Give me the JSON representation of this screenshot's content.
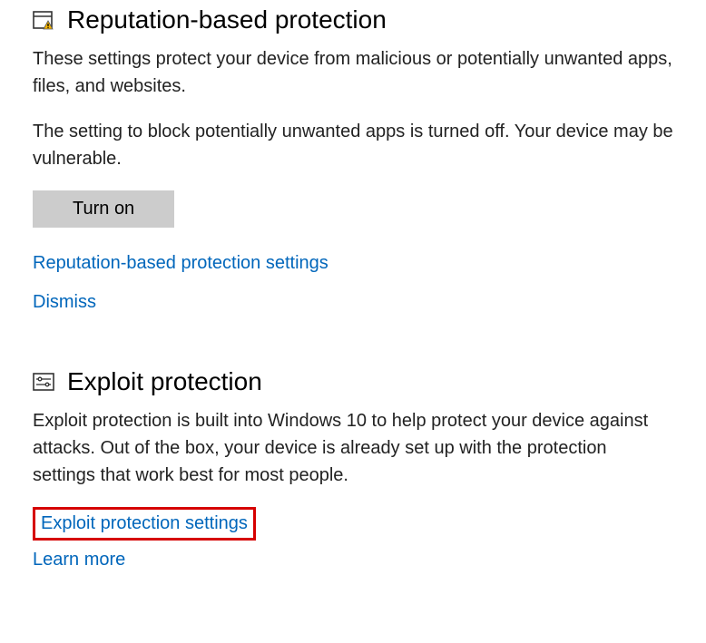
{
  "reputation": {
    "title": "Reputation-based protection",
    "icon": "app-warning-icon",
    "desc1": "These settings protect your device from malicious or potentially unwanted apps, files, and websites.",
    "desc2": "The setting to block potentially unwanted apps is turned off. Your device may be vulnerable.",
    "button_label": "Turn on",
    "settings_link": "Reputation-based protection settings",
    "dismiss_link": "Dismiss"
  },
  "exploit": {
    "title": "Exploit protection",
    "icon": "sliders-icon",
    "desc": "Exploit protection is built into Windows 10 to help protect your device against attacks.  Out of the box, your device is already set up with the protection settings that work best for most people.",
    "settings_link": "Exploit protection settings",
    "learn_more_link": "Learn more"
  }
}
